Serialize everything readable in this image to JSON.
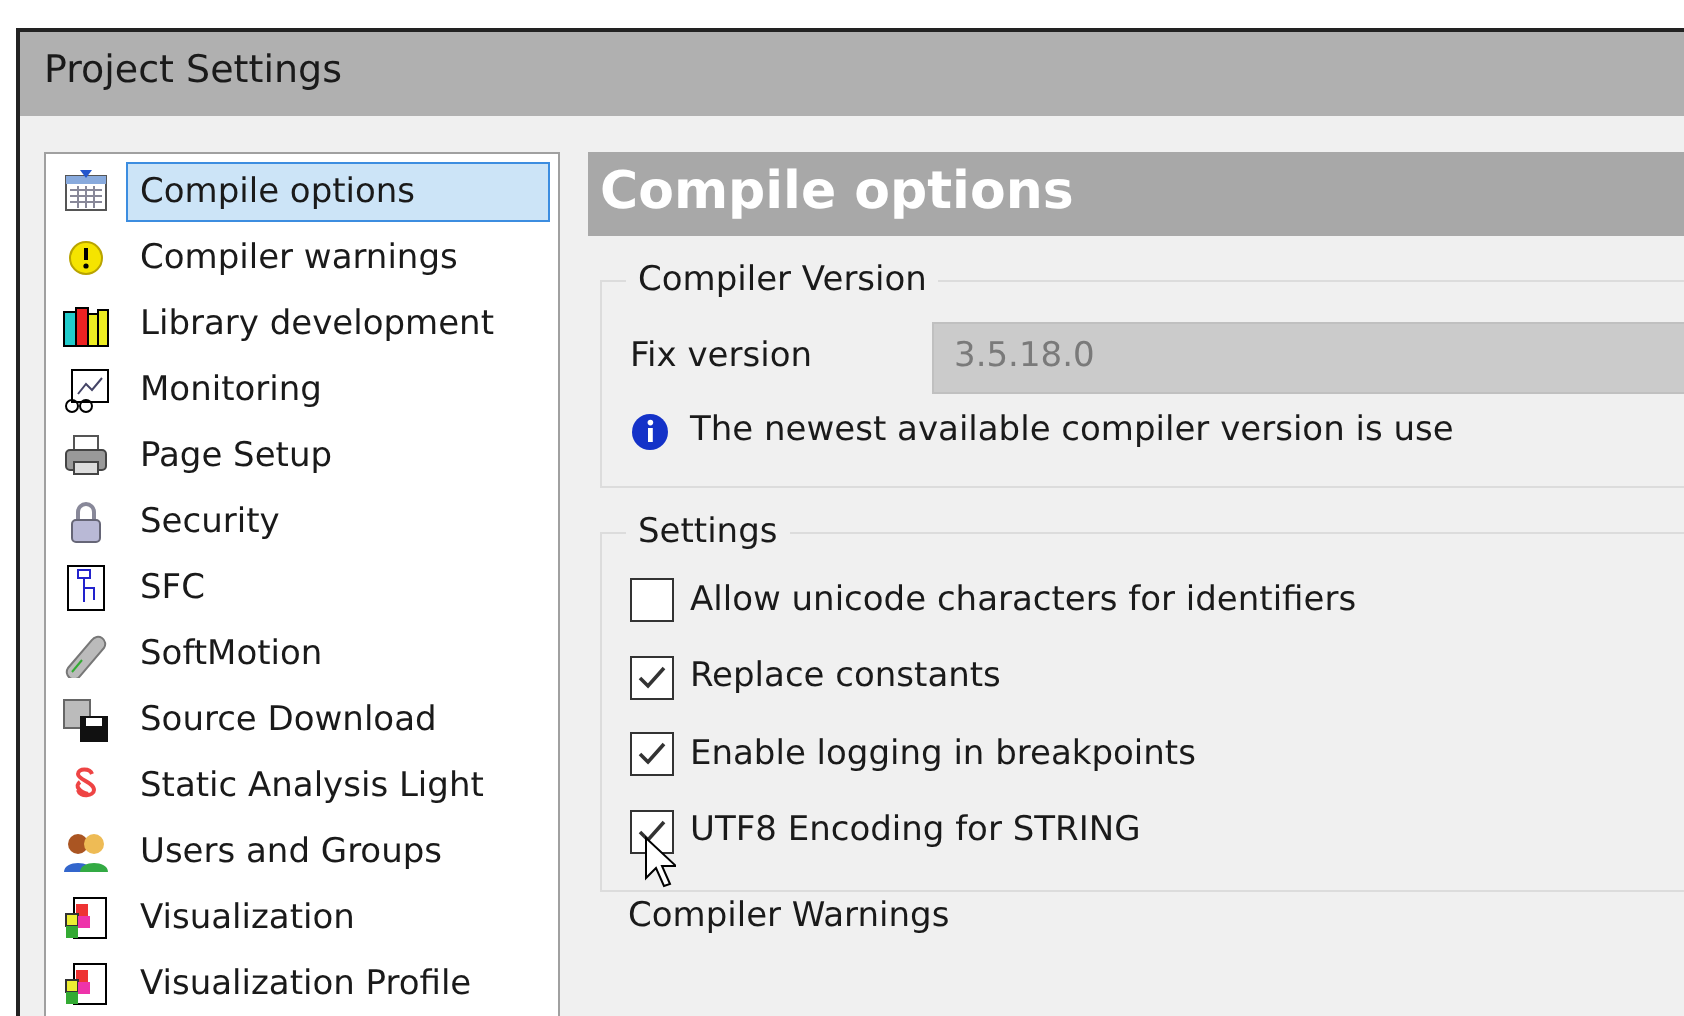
{
  "window": {
    "title": "Project Settings"
  },
  "sidebar": {
    "items": [
      {
        "label": "Compile options",
        "selected": true
      },
      {
        "label": "Compiler warnings",
        "selected": false
      },
      {
        "label": "Library development",
        "selected": false
      },
      {
        "label": "Monitoring",
        "selected": false
      },
      {
        "label": "Page Setup",
        "selected": false
      },
      {
        "label": "Security",
        "selected": false
      },
      {
        "label": "SFC",
        "selected": false
      },
      {
        "label": "SoftMotion",
        "selected": false
      },
      {
        "label": "Source Download",
        "selected": false
      },
      {
        "label": "Static Analysis Light",
        "selected": false
      },
      {
        "label": "Users and Groups",
        "selected": false
      },
      {
        "label": "Visualization",
        "selected": false
      },
      {
        "label": "Visualization Profile",
        "selected": false
      }
    ]
  },
  "panel": {
    "title": "Compile options",
    "compiler_version": {
      "legend": "Compiler Version",
      "field_label": "Fix version",
      "field_value": "3.5.18.0",
      "disabled": true,
      "info": "The newest available compiler version is use"
    },
    "settings": {
      "legend": "Settings",
      "options": [
        {
          "label": "Allow unicode characters for identifiers",
          "checked": false
        },
        {
          "label": "Replace constants",
          "checked": true
        },
        {
          "label": "Enable logging in breakpoints",
          "checked": true
        },
        {
          "label": "UTF8 Encoding for STRING",
          "checked": true
        }
      ]
    },
    "next_section": {
      "legend": "Compiler Warnings"
    }
  }
}
